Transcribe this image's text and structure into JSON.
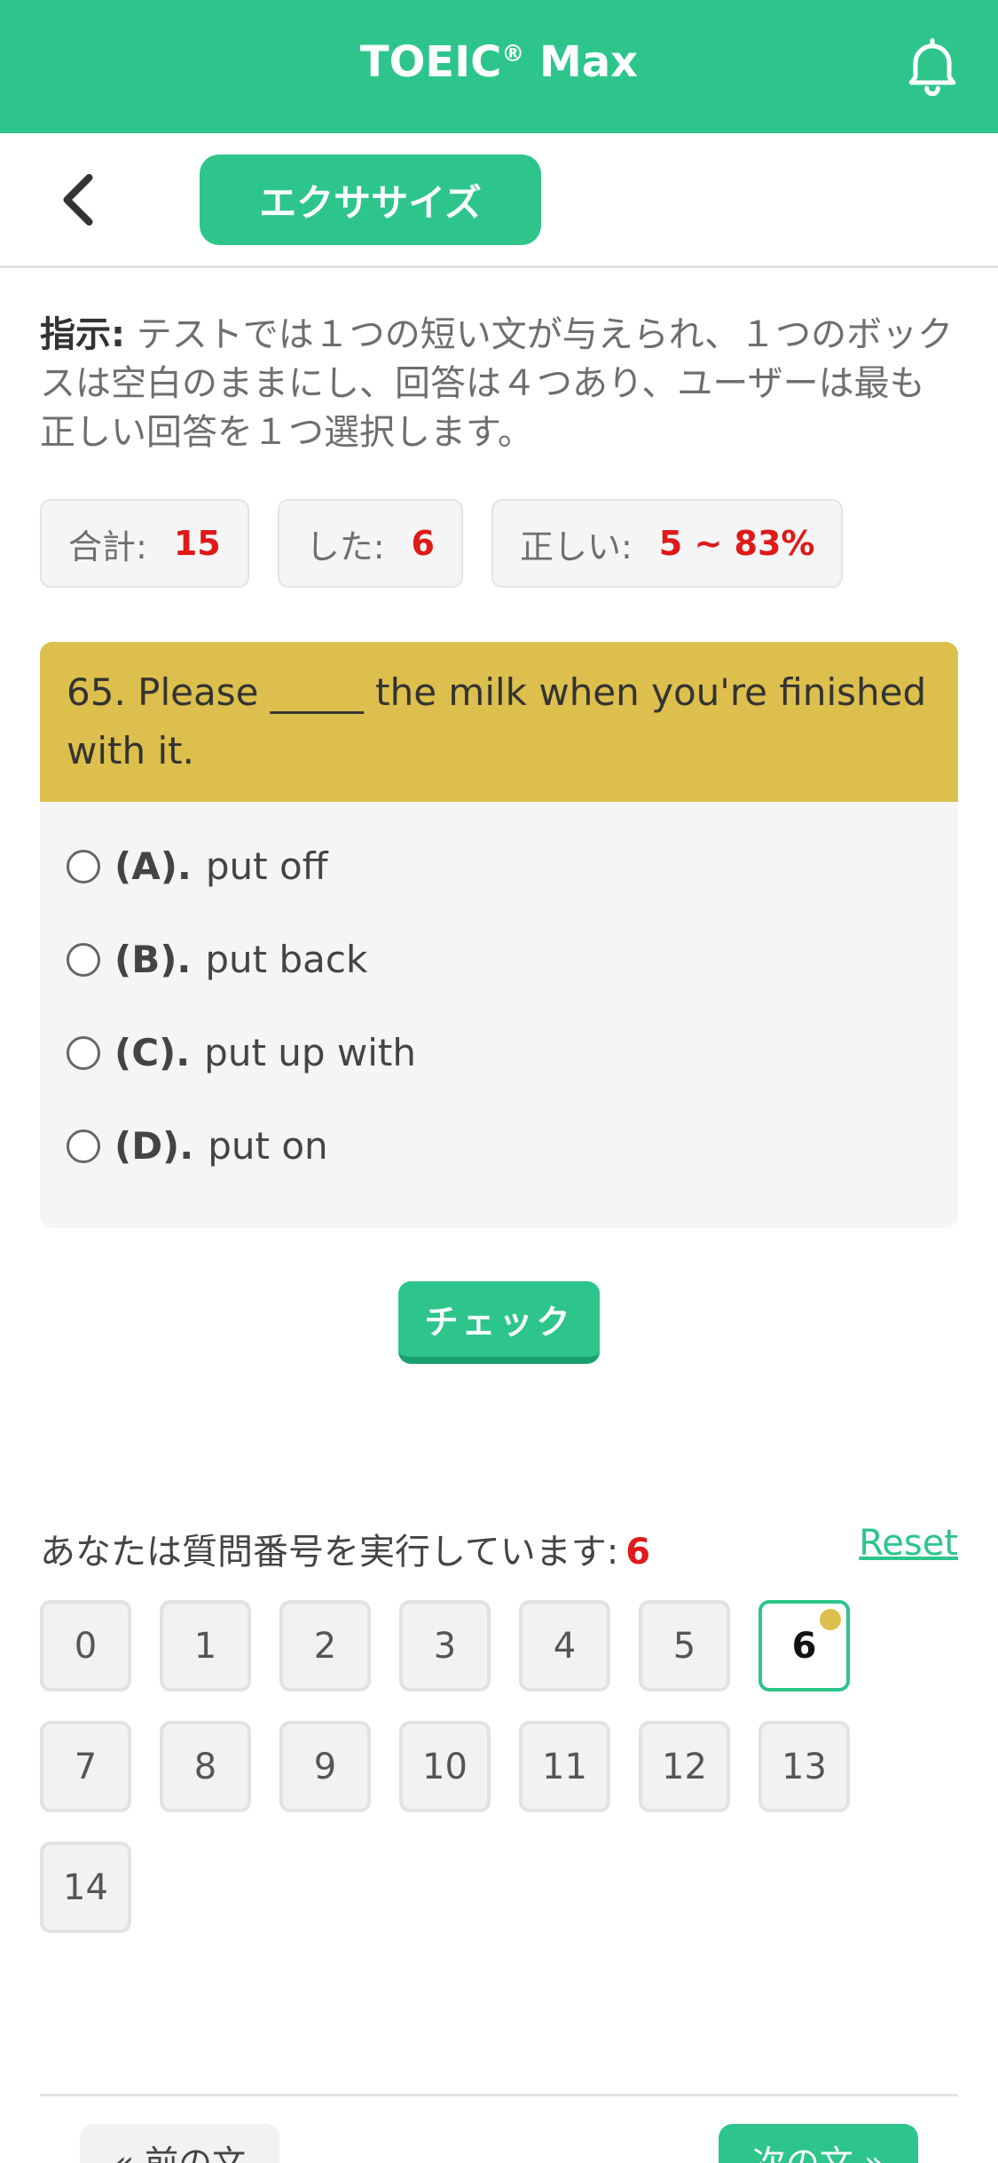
{
  "header": {
    "title": "TOEIC",
    "title_mark": "®",
    "title_suffix": " Max",
    "bell_icon": "bell-icon"
  },
  "subbar": {
    "back_icon": "chevron-left-icon",
    "tab_label": "エクササイズ"
  },
  "instructions": {
    "label": "指示:",
    "text": " テストでは１つの短い文が与えられ、１つのボックスは空白のままにし、回答は４つあり、ユーザーは最も正しい回答を１つ選択します。"
  },
  "stats": {
    "total_label": "合計:",
    "total_value": "15",
    "done_label": "した:",
    "done_value": "6",
    "correct_label": "正しい:",
    "correct_value": "5 ~ 83%"
  },
  "question": {
    "text": "65. Please _____ the milk when you're finished with it.",
    "options": [
      {
        "label": "(A).",
        "text": "put off"
      },
      {
        "label": "(B).",
        "text": "put back"
      },
      {
        "label": "(C).",
        "text": "put up with"
      },
      {
        "label": "(D).",
        "text": "put on"
      }
    ]
  },
  "check_label": "チェック",
  "progress": {
    "label": "あなたは質問番号を実行しています:",
    "current": "6",
    "reset_label": "Reset",
    "numbers": [
      "0",
      "1",
      "2",
      "3",
      "4",
      "5",
      "6",
      "7",
      "8",
      "9",
      "10",
      "11",
      "12",
      "13",
      "14"
    ]
  },
  "nav": {
    "prev_label": "« 前の文",
    "next_label": "次の文 »"
  },
  "colors": {
    "brand": "#2dc58b",
    "question_bg": "#dcbf4c",
    "highlight_red": "#e01919"
  }
}
